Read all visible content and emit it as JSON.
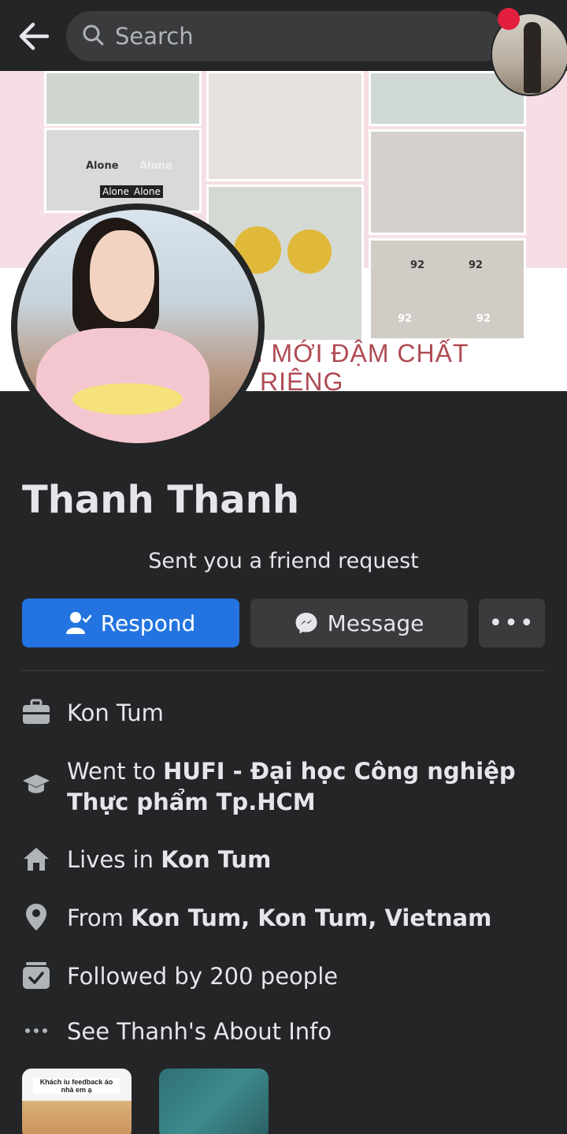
{
  "header": {
    "search_label": "Search"
  },
  "cover": {
    "panel_labels": [
      "Alone",
      "Alone",
      "Alone",
      "Alone",
      "92",
      "92",
      "92",
      "92"
    ],
    "promo_line1": "M MỚI ĐẬM CHẤT",
    "promo_line2": "RIÊNG"
  },
  "profile": {
    "name": "Thanh Thanh",
    "subtitle": "Sent you a friend request"
  },
  "actions": {
    "respond_label": "Respond",
    "message_label": "Message",
    "more_label": "•••"
  },
  "info": {
    "work": "Kon Tum",
    "edu_prefix": "Went to ",
    "edu_place": "HUFI - Đại học Công nghiệp Thực phẩm Tp.HCM",
    "lives_prefix": "Lives in ",
    "lives_place": "Kon Tum",
    "from_prefix": "From ",
    "from_place": "Kon Tum, Kon Tum, Vietnam",
    "followed": "Followed by 200 people",
    "about": "See Thanh's About Info"
  },
  "thumbnails": {
    "thumb1_caption": "Khách iu feedback áo nhà em ạ"
  },
  "colors": {
    "accent": "#2374e1",
    "background": "#242526",
    "button_secondary": "#3a3b3c"
  }
}
